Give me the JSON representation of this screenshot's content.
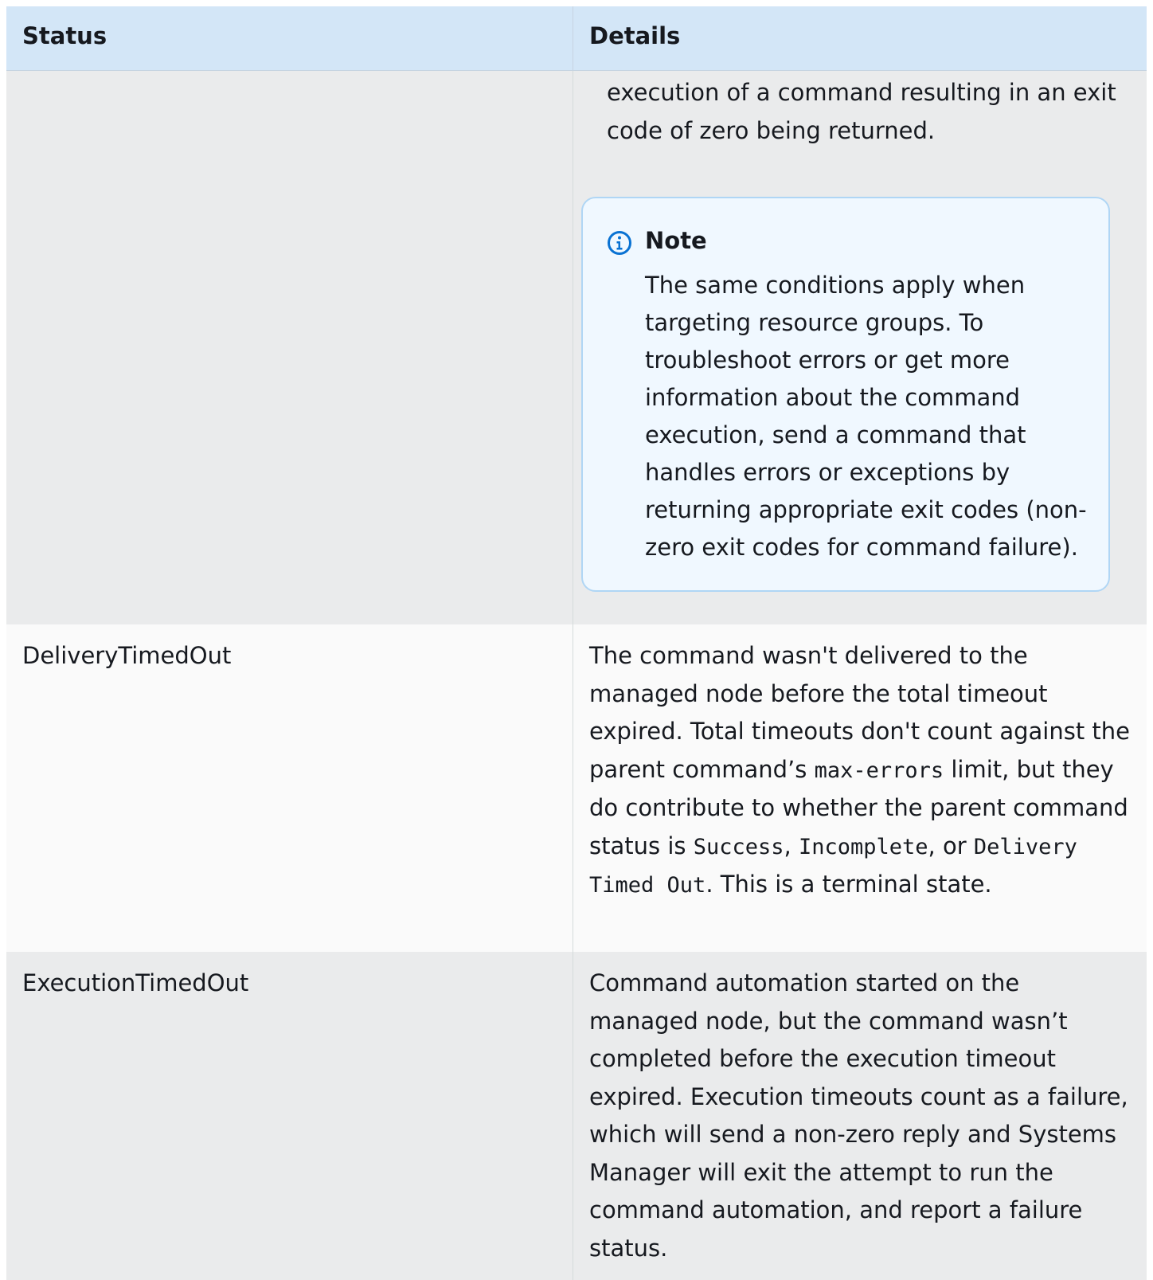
{
  "table": {
    "headers": {
      "status": "Status",
      "details": "Details"
    },
    "row1": {
      "details_continued": "execution of a command resulting in an exit code of zero being returned.",
      "note": {
        "title": "Note",
        "body": "The same conditions apply when targeting resource groups. To troubleshoot errors or get more information about the command execution, send a command that handles errors or exceptions by returning appropriate exit codes (non-zero exit codes for command failure)."
      }
    },
    "row2": {
      "status": "DeliveryTimedOut",
      "details_1": "The command wasn't delivered to the managed node before the total timeout expired. Total timeouts don't count against the parent command’s",
      "code_1": "max-errors",
      "details_2": " limit, but they do contribute to whether the parent command status is",
      "code_2": "Success",
      "details_3": ",",
      "code_3": "Incomplete",
      "details_4": ", or",
      "code_4": "Delivery Timed Out",
      "details_5": ". This is a terminal state."
    },
    "row3": {
      "status": "ExecutionTimedOut",
      "details": "Command automation started on the managed node, but the command wasn’t completed before the execution timeout expired. Execution timeouts count as a failure, which will send a non-zero reply and Systems Manager will exit the attempt to run the command automation, and report a failure status."
    }
  },
  "colors": {
    "header_bg": "#d3e6f7",
    "row_shaded_bg": "#eaebec",
    "row_light_bg": "#fafafa",
    "note_bg": "#f0f8ff",
    "note_border": "#b0d6f5",
    "info_icon": "#0972d3"
  },
  "icons": {
    "note_icon": "info-icon"
  }
}
